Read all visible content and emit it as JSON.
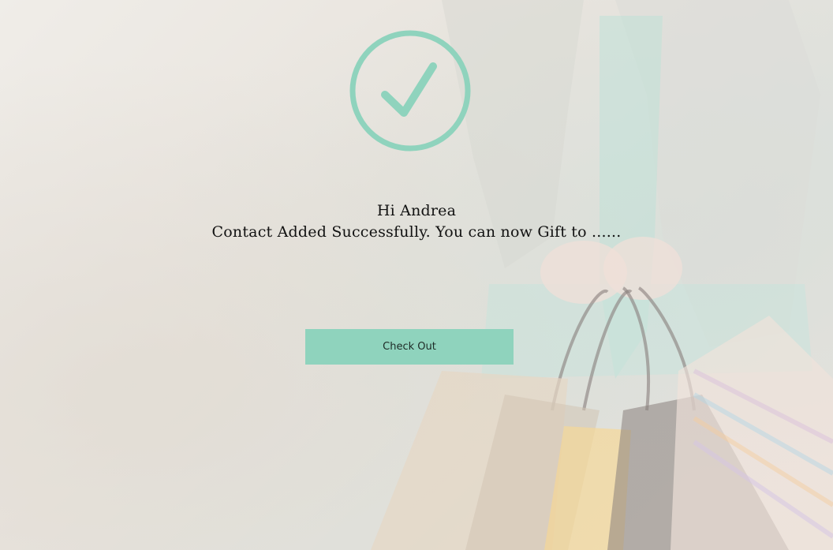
{
  "dialog": {
    "greeting": "Hi Andrea",
    "message": "Contact Added Successfully. You can now Gift to ......",
    "checkout_label": "Check Out"
  },
  "icons": {
    "status": "check-circle-icon"
  },
  "colors": {
    "accent": "#8fd3bd"
  }
}
